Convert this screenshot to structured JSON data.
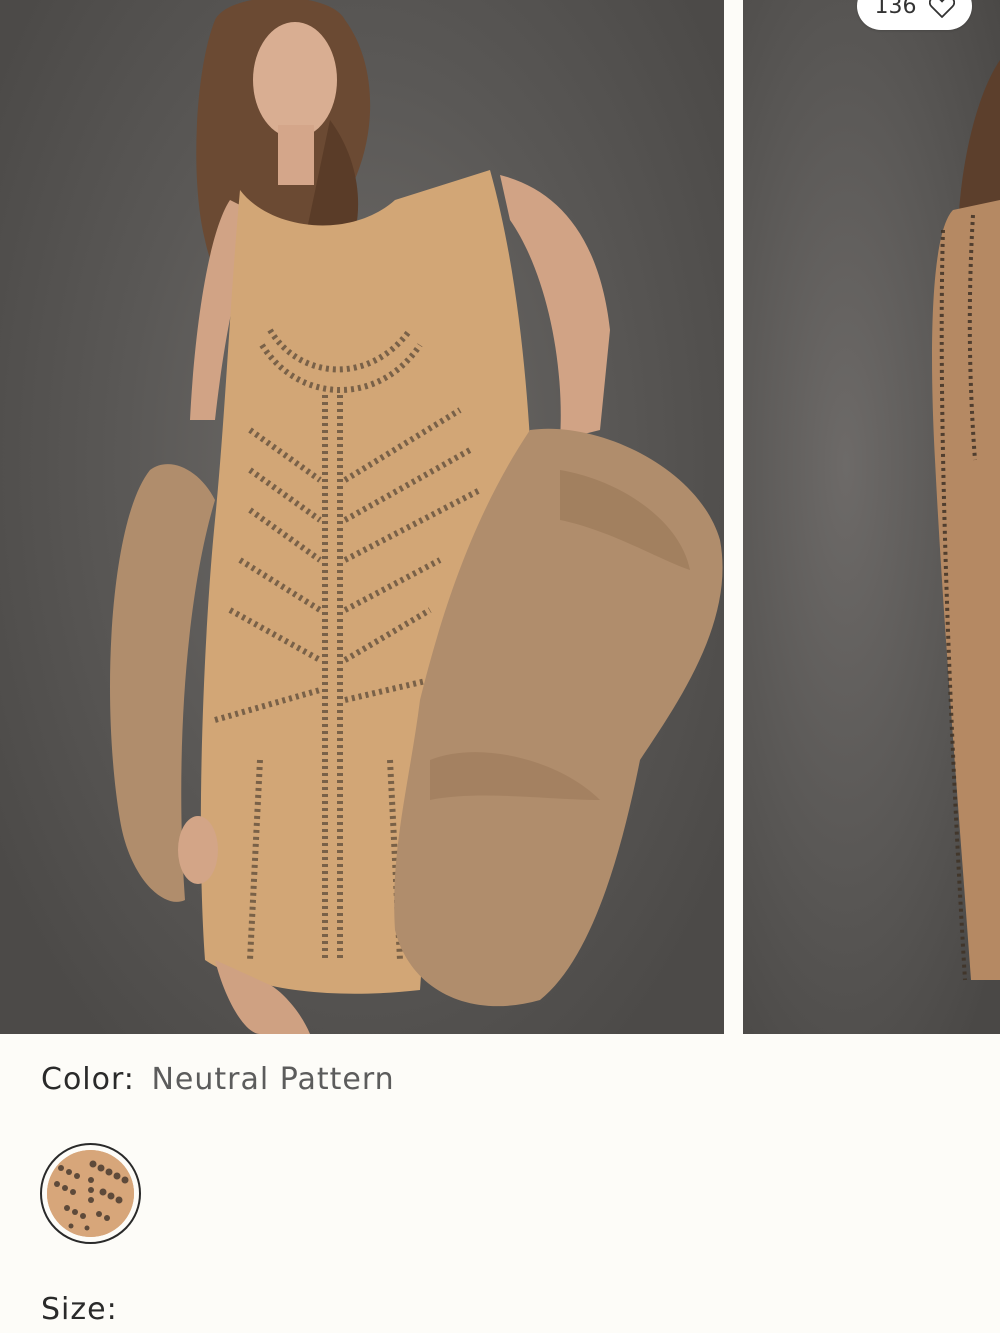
{
  "gallery": {
    "slides": [
      {
        "alt": "Model wearing beaded sleeveless mini dress with faux fur coat"
      },
      {
        "alt": "Beaded mini dress side view"
      }
    ],
    "likes": {
      "count": "136",
      "icon": "heart-outline-icon"
    }
  },
  "product": {
    "color": {
      "label": "Color:",
      "value": "Neutral Pattern",
      "swatches": [
        {
          "name": "Neutral Pattern",
          "selected": true,
          "base_color": "#d7a67a"
        }
      ]
    },
    "size": {
      "label": "Size:"
    }
  },
  "colors": {
    "background": "#fdfcf8",
    "text": "#2a2a2a",
    "muted_text": "#5c5c5c",
    "photo_backdrop": "#5a5856",
    "dress": "#d2a676",
    "coat": "#b08d6c"
  }
}
